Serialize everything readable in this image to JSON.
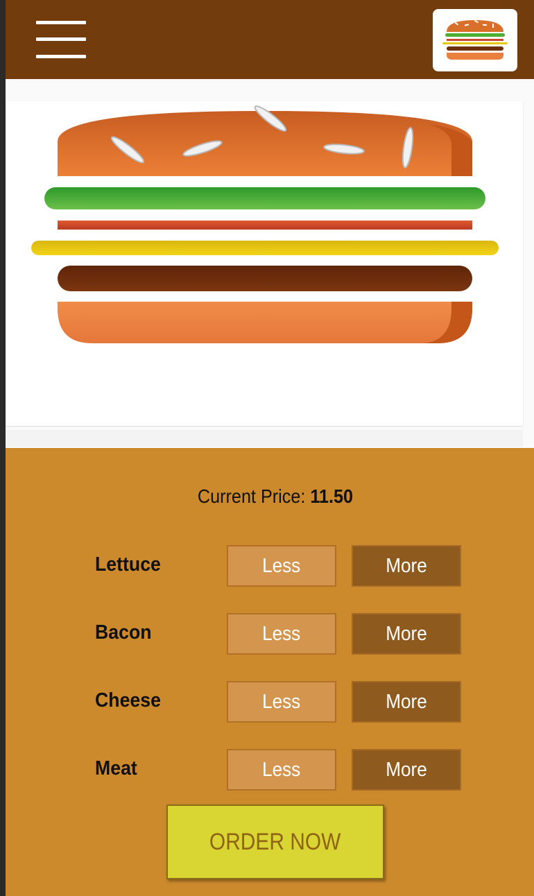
{
  "header": {
    "menu_icon": "hamburger-menu-icon",
    "logo_icon": "burger-logo-icon"
  },
  "hero": {
    "image": "burger-illustration",
    "colors": {
      "bun": "#e07a34",
      "lettuce": "#3fa535",
      "bacon": "#c9472a",
      "cheese": "#e8c90e",
      "meat": "#6e2e0a"
    }
  },
  "controls": {
    "price_label": "Current Price:",
    "price_value": "11.50",
    "rows": [
      {
        "label": "Lettuce",
        "less": "Less",
        "more": "More"
      },
      {
        "label": "Bacon",
        "less": "Less",
        "more": "More"
      },
      {
        "label": "Cheese",
        "less": "Less",
        "more": "More"
      },
      {
        "label": "Meat",
        "less": "Less",
        "more": "More"
      }
    ],
    "order_label": "ORDER NOW"
  },
  "colors": {
    "header_bg": "#733c0c",
    "panel_bg": "#cd8a2c",
    "less_bg": "#d4954e",
    "more_bg": "#8f5a1e",
    "order_bg": "#d9d533"
  }
}
